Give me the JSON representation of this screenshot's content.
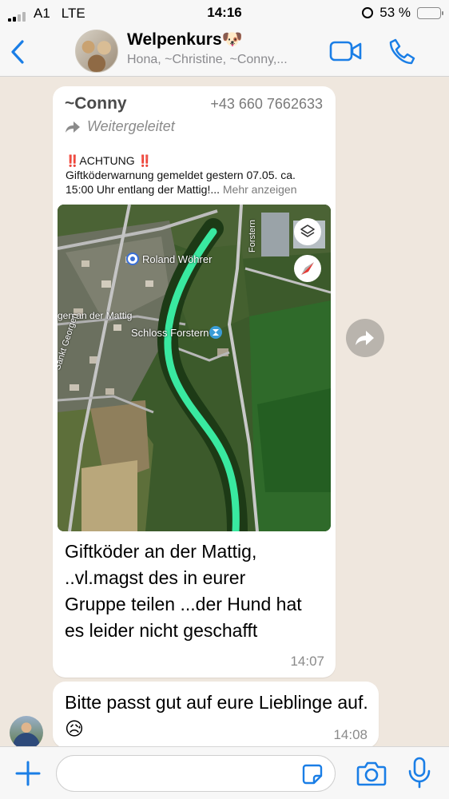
{
  "status_bar": {
    "carrier": "A1",
    "network": "LTE",
    "time": "14:16",
    "battery_percent": "53 %",
    "battery_level": 0.53
  },
  "header": {
    "title": "Welpenkurs🐶",
    "subtitle": "Hona, ~Christine, ~Conny,...",
    "accent_color": "#1a7ee6"
  },
  "messages": [
    {
      "sender": "~Conny",
      "phone": "+43 660 7662633",
      "forwarded_label": "Weitergeleitet",
      "preview_title": "‼️ACHTUNG ‼️",
      "preview_body": "Giftköderwarnung gemeldet gestern 07.05. ca. 15:00 Uhr entlang der Mattig!...",
      "preview_more": "Mehr anzeigen",
      "map_labels": {
        "place1": "Roland Wöhrer",
        "place2": "Schloss Forstern",
        "road1": "gen an der Mattig",
        "road2": "Sankt Georgen",
        "road3": "Forstern"
      },
      "text": "Giftköder an der Mattig, ..vl.magst des in eurer Gruppe teilen ...der Hund hat es leider nicht geschafft",
      "time": "14:07"
    },
    {
      "text": "Bitte passt gut auf eure Lieblinge auf.😥",
      "time": "14:08"
    }
  ]
}
